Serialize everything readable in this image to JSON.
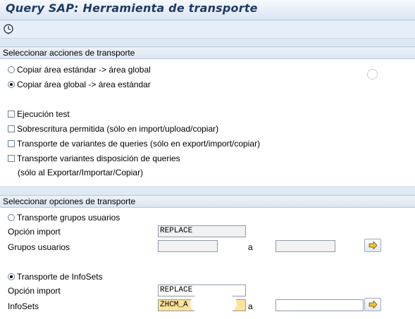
{
  "window": {
    "title": "Query SAP: Herramienta de transporte"
  },
  "toolbar": {
    "execute_icon": "execute-clock-icon"
  },
  "actions": {
    "header": "Seleccionar acciones de transporte",
    "radio_std_to_global": "Copiar área estándar -> área global",
    "radio_global_to_std": "Copiar área global -> área estándar",
    "selected_radio": "global_to_std",
    "chk_test": "Ejecución test",
    "chk_overwrite": "Sobrescritura permitida (sólo en import/upload/copiar)",
    "chk_query_variants": "Transporte de variantes de queries (sólo en export/import/copiar)",
    "chk_layout_variants": "Transporte variantes disposición de queries",
    "layout_variants_note": "(sólo al Exportar/Importar/Copiar)"
  },
  "options": {
    "header": "Seleccionar opciones de transporte",
    "user_groups_radio": "Transporte grupos usuarios",
    "import_option_label": "Opción import",
    "import_option_value_1": "REPLACE",
    "user_groups_label": "Grupos usuarios",
    "to_label": "a",
    "infosets_radio": "Transporte de InfoSets",
    "import_option_value_2": "REPLACE",
    "infosets_label": "InfoSets",
    "infosets_from_value": "ZHCM_A"
  }
}
